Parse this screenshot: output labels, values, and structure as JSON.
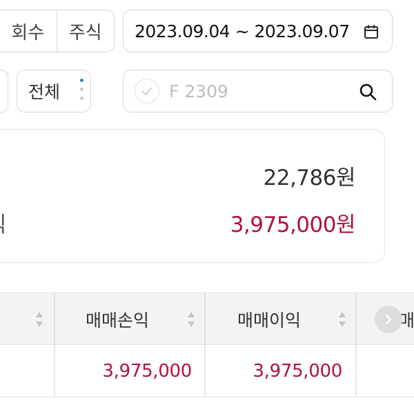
{
  "filters": {
    "segment_left": "회수",
    "segment_right": "주식",
    "date_range": "2023.09.04 ~ 2023.09.07",
    "all_label": "전체",
    "search_value": "F 2309"
  },
  "summary": {
    "value1": "22,786원",
    "label2": "익",
    "value2": "3,975,000원"
  },
  "table": {
    "headers": [
      "매매손익",
      "매매이익",
      "매"
    ],
    "rows": [
      {
        "pnl": "3,975,000",
        "profit": "3,975,000"
      }
    ]
  },
  "colors": {
    "accent": "#b0123c",
    "border": "#d6d6d6",
    "header_bg": "#f3f3f3"
  },
  "icons": [
    "calendar-icon",
    "check-icon",
    "search-icon",
    "sort-icon",
    "chevron-right-icon",
    "kebab-icon"
  ]
}
